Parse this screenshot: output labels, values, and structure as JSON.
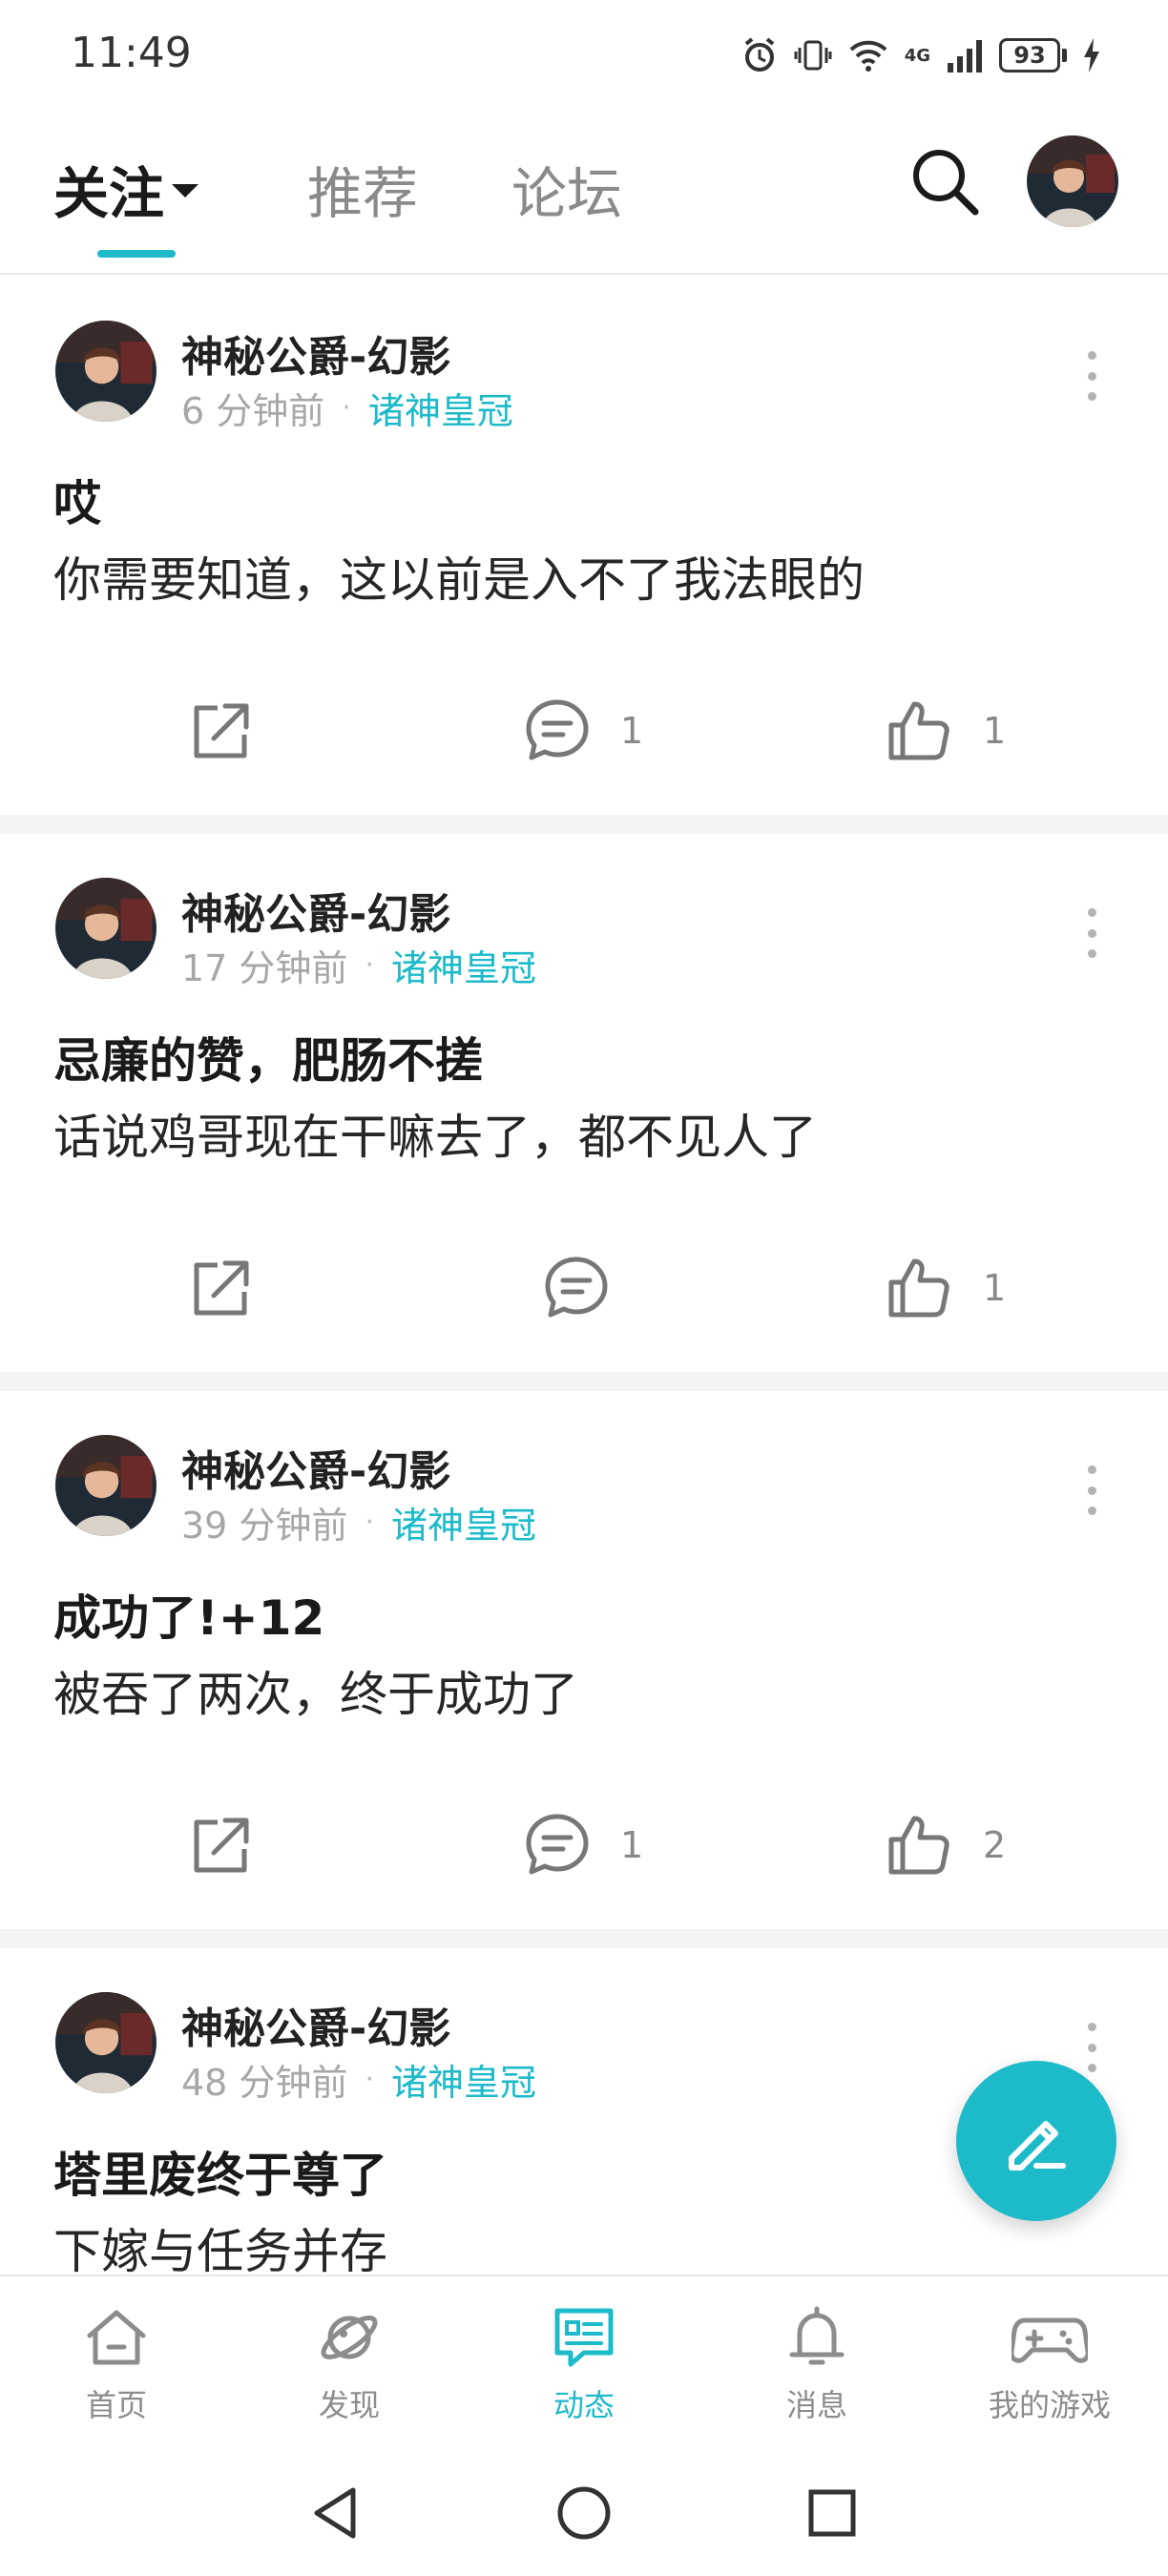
{
  "status_bar": {
    "time": "11:49",
    "battery": "93",
    "network": "4G"
  },
  "top_nav": {
    "tabs": [
      {
        "label": "关注",
        "active": true
      },
      {
        "label": "推荐",
        "active": false
      },
      {
        "label": "论坛",
        "active": false
      }
    ],
    "accent_color": "#1dbac9"
  },
  "posts": [
    {
      "author": "神秘公爵-幻影",
      "time": "6 分钟前",
      "forum": "诸神皇冠",
      "title": "哎",
      "body": "你需要知道，这以前是入不了我法眼的",
      "comments": "1",
      "likes": "1"
    },
    {
      "author": "神秘公爵-幻影",
      "time": "17 分钟前",
      "forum": "诸神皇冠",
      "title": "忌廉的赞，肥肠不搓",
      "body": "话说鸡哥现在干嘛去了，都不见人了",
      "comments": "",
      "likes": "1"
    },
    {
      "author": "神秘公爵-幻影",
      "time": "39 分钟前",
      "forum": "诸神皇冠",
      "title": "成功了!+12",
      "body": "被吞了两次，终于成功了",
      "comments": "1",
      "likes": "2"
    },
    {
      "author": "神秘公爵-幻影",
      "time": "48 分钟前",
      "forum": "诸神皇冠",
      "title": "塔里废终于尊了",
      "body": "下嫁与任务并存",
      "comments": "",
      "likes": ""
    }
  ],
  "bottom_nav": [
    {
      "label": "首页",
      "icon": "home-icon",
      "active": false
    },
    {
      "label": "发现",
      "icon": "planet-icon",
      "active": false
    },
    {
      "label": "动态",
      "icon": "feed-icon",
      "active": true
    },
    {
      "label": "消息",
      "icon": "bell-icon",
      "active": false
    },
    {
      "label": "我的游戏",
      "icon": "gamepad-icon",
      "active": false
    }
  ]
}
